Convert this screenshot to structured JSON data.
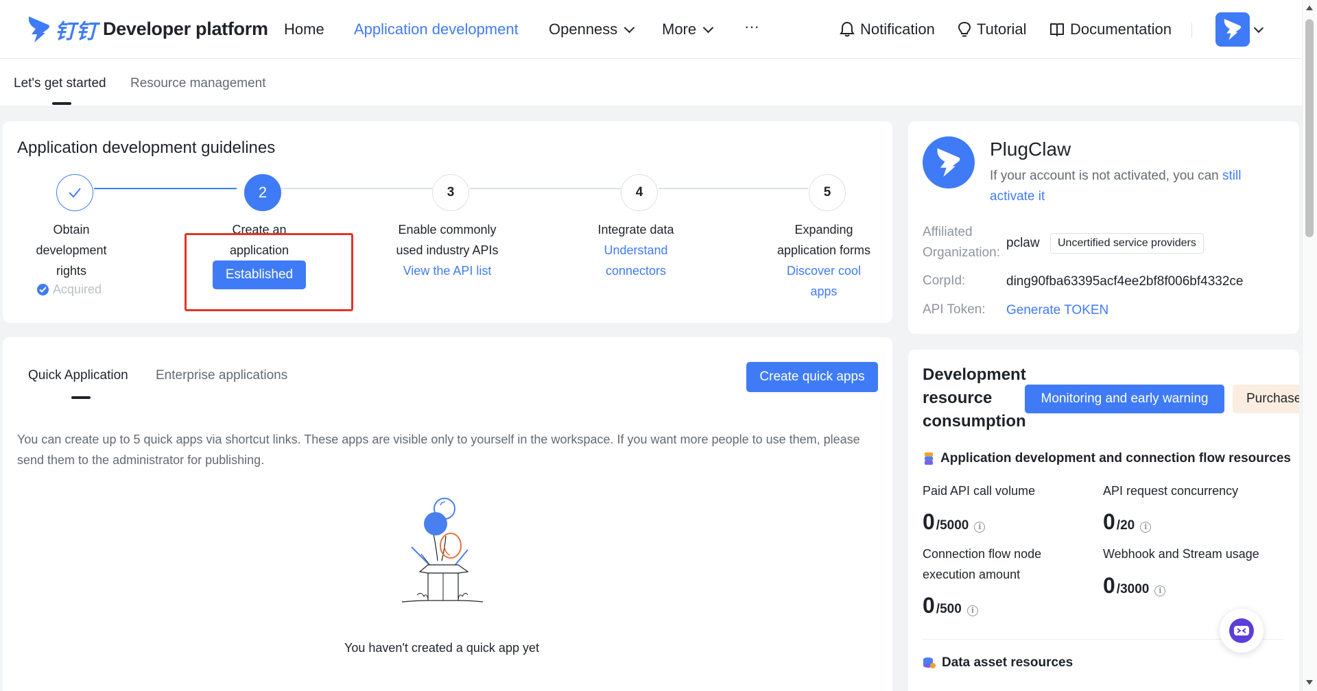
{
  "brand": {
    "logo_cn": "钉钉",
    "title": "Developer platform"
  },
  "nav": {
    "home": "Home",
    "app_dev": "Application development",
    "openness": "Openness",
    "more": "More",
    "ellipsis": "···",
    "notification": "Notification",
    "tutorial": "Tutorial",
    "documentation": "Documentation"
  },
  "subtabs": {
    "started": "Let's get started",
    "resource": "Resource management"
  },
  "guide": {
    "title": "Application development guidelines",
    "steps": [
      {
        "number": "",
        "lines": [
          "Obtain",
          "development",
          "rights"
        ],
        "status": "Acquired"
      },
      {
        "number": "2",
        "lines": [
          "Create an",
          "application"
        ],
        "button": "Established"
      },
      {
        "number": "3",
        "lines": [
          "Enable commonly",
          "used industry APIs"
        ],
        "link": "View the API list"
      },
      {
        "number": "4",
        "lines": [
          "Integrate data"
        ],
        "link_lines": [
          "Understand",
          "connectors"
        ]
      },
      {
        "number": "5",
        "lines": [
          "Expanding",
          "application forms"
        ],
        "link_lines": [
          "Discover cool",
          "apps"
        ]
      }
    ]
  },
  "quick": {
    "tab_quick": "Quick Application",
    "tab_enterprise": "Enterprise applications",
    "create_button": "Create quick apps",
    "description": "You can create up to 5 quick apps via shortcut links. These apps are visible only to yourself in the workspace. If you want more people to use them, please send them to the administrator for publishing.",
    "empty": "You haven't created a quick app yet"
  },
  "org": {
    "name": "PlugClaw",
    "note_prefix": "If your account is not activated, you can ",
    "note_link": "still activate it",
    "affiliated_label_1": "Affiliated",
    "affiliated_label_2": "Organization:",
    "affiliated_value": "pclaw",
    "badge": "Uncertified service providers",
    "corpid_label": "CorpId:",
    "corpid_value": "ding90fba63395acf4ee2bf8f006bf4332ce",
    "token_label": "API Token:",
    "token_link": "Generate TOKEN"
  },
  "resources": {
    "title_lines": [
      "Development",
      "resource",
      "consumption"
    ],
    "monitor_button": "Monitoring and early warning",
    "purchase_button": "Purchase",
    "section1": "Application development and connection flow resources",
    "metrics": [
      {
        "label": "Paid API call volume",
        "value": "0",
        "total": "/5000"
      },
      {
        "label": "API request concurrency",
        "value": "0",
        "total": "/20"
      },
      {
        "label": "Connection flow node execution amount",
        "value": "0",
        "total": "/500"
      },
      {
        "label": "Webhook and Stream usage",
        "value": "0",
        "total": "/3000"
      }
    ],
    "section2": "Data asset resources"
  },
  "colors": {
    "accent": "#3f7bf6",
    "highlight": "#e0352b",
    "purchase_bg": "#fbeee0"
  }
}
